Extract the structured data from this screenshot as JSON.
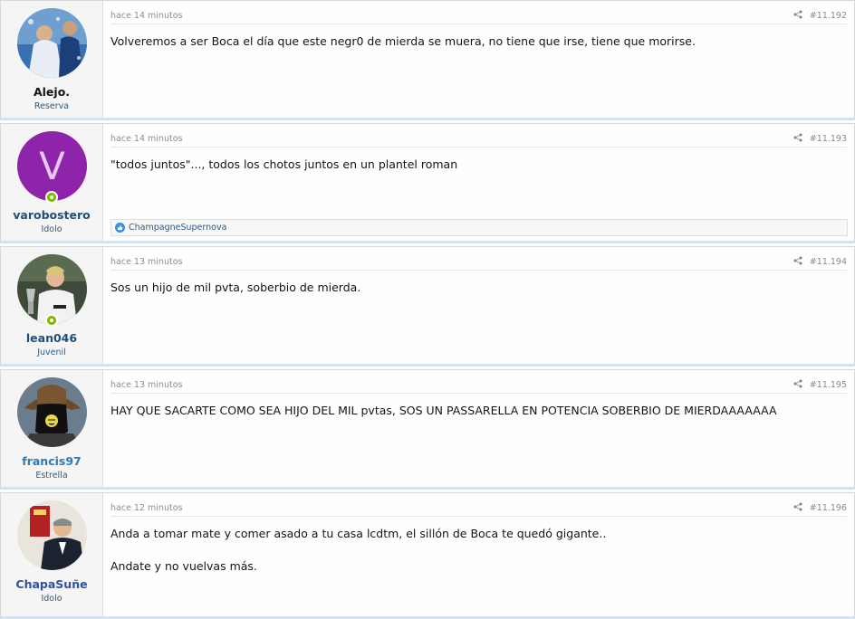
{
  "posts": [
    {
      "user": {
        "name": "Alejo.",
        "title": "Reserva",
        "avatar": "photo-avatar"
      },
      "time": "hace 14 minutos",
      "number": "#11.192",
      "message": [
        "Volveremos a ser Boca el día que este negr0 de mierda se muera, no tiene que irse, tiene que morirse."
      ]
    },
    {
      "user": {
        "name": "varobostero",
        "title": "Idolo",
        "avatar_letter": "V"
      },
      "time": "hace 14 minutos",
      "number": "#11.193",
      "message": [
        "\"todos juntos\"..., todos los chotos juntos en un plantel roman"
      ],
      "reaction": "ChampagneSupernova"
    },
    {
      "user": {
        "name": "lean046",
        "title": "Juvenil",
        "avatar": "photo-avatar"
      },
      "time": "hace 13 minutos",
      "number": "#11.194",
      "message": [
        "Sos un hijo de mil pvta, soberbio de mierda."
      ]
    },
    {
      "user": {
        "name": "francis97",
        "title": "Estrella",
        "avatar": "photo-avatar"
      },
      "time": "hace 13 minutos",
      "number": "#11.195",
      "message": [
        "HAY QUE SACARTE COMO SEA HIJO DEL MIL pvtas, SOS UN PASSARELLA EN POTENCIA SOBERBIO DE MIERDAAAAAAA"
      ]
    },
    {
      "user": {
        "name": "ChapaSuñe",
        "title": "Idolo",
        "avatar": "photo-avatar"
      },
      "time": "hace 12 minutos",
      "number": "#11.196",
      "message": [
        "Anda a tomar mate y comer asado a tu casa lcdtm, el sillón de Boca te quedó gigante..",
        "Andate y no vuelvas más."
      ]
    }
  ],
  "colors": {
    "accent": "#2b5a84",
    "online": "#7fb900",
    "avatar_v": "#8e24aa"
  },
  "icons": {
    "share": "share-icon",
    "like": "like-icon",
    "online": "online-indicator"
  }
}
